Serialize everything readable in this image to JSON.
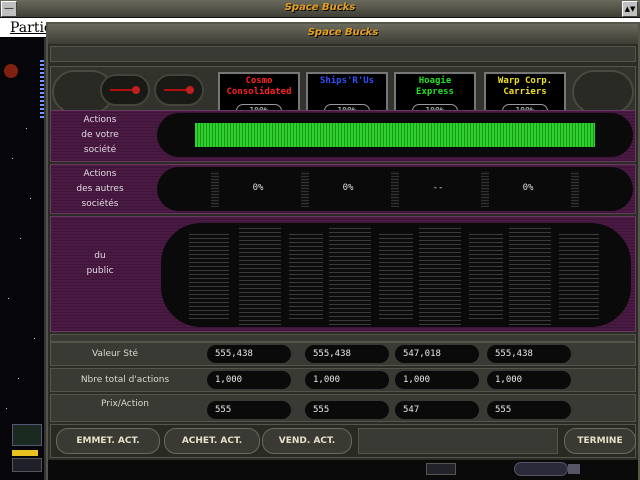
{
  "outer": {
    "title": "Space Bucks",
    "menu_item": "Partie",
    "sys_left": "—",
    "sys_right": "▲▼"
  },
  "dialog": {
    "title": "Space Bucks"
  },
  "companies": [
    {
      "name_line1": "Cosmo",
      "name_line2": "Consolidated",
      "color": "#ff2020",
      "pct": "100%"
    },
    {
      "name_line1": "Ships'R'Us",
      "name_line2": "",
      "color": "#3050ff",
      "pct": "100%"
    },
    {
      "name_line1": "Hoagie",
      "name_line2": "Express",
      "color": "#20e020",
      "pct": "100%"
    },
    {
      "name_line1": "Warp Corp.",
      "name_line2": "Carriers",
      "color": "#f0e020",
      "pct": "100%"
    }
  ],
  "sections": {
    "own": {
      "line1": "Actions",
      "line2": "de votre",
      "line3": "société",
      "fill": 1.0,
      "bar_color": "#20c020"
    },
    "others": {
      "line1": "Actions",
      "line2": "des autres",
      "line3": "sociétés",
      "values": [
        "0%",
        "0%",
        "--",
        "0%"
      ]
    },
    "public": {
      "line1": "du",
      "line2": "public"
    }
  },
  "table": {
    "rows": [
      {
        "label": "Valeur Sté",
        "values": [
          "555,438",
          "555,438",
          "547,018",
          "555,438"
        ]
      },
      {
        "label": "Nbre total d'actions",
        "values": [
          "1,000",
          "1,000",
          "1,000",
          "1,000"
        ]
      },
      {
        "label": "Prix/Action",
        "values": [
          "555",
          "555",
          "547",
          "555"
        ]
      }
    ]
  },
  "buttons": {
    "emit": "EMMET. ACT.",
    "buy": "ACHET. ACT.",
    "sell": "VEND. ACT.",
    "done": "TERMINE"
  }
}
